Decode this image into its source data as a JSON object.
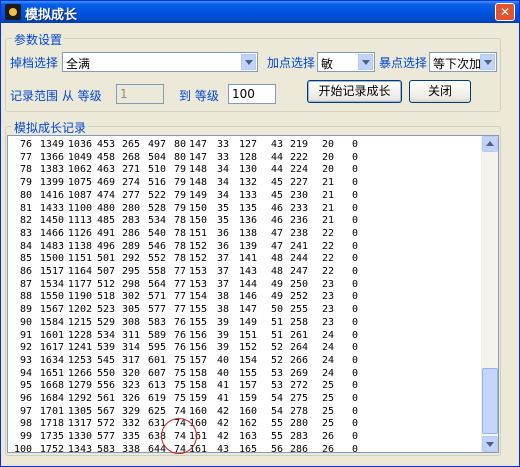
{
  "window": {
    "title": "模拟成长",
    "close_glyph": "✕"
  },
  "settings": {
    "legend": "参数设置",
    "grade_label": "掉档选择",
    "grade_value": "全满",
    "bonus_label": "加点选择",
    "bonus_value": "敏",
    "crit_label": "暴点选择",
    "crit_value": "等下次加",
    "range_label": "记录范围 从 等级",
    "range_from": "1",
    "range_to_label": "到 等级",
    "range_to": "100",
    "start_button": "开始记录成长",
    "close_button": "关闭"
  },
  "records": {
    "legend": "模拟成长记录",
    "rows": [
      [
        "76",
        "1349",
        "1036",
        "453",
        "265",
        "497",
        "80",
        "147",
        "33",
        "127",
        "43",
        "219",
        "20",
        "0"
      ],
      [
        "77",
        "1366",
        "1049",
        "458",
        "268",
        "504",
        "80",
        "147",
        "33",
        "128",
        "44",
        "222",
        "20",
        "0"
      ],
      [
        "78",
        "1383",
        "1062",
        "463",
        "271",
        "510",
        "79",
        "148",
        "34",
        "130",
        "44",
        "224",
        "20",
        "0"
      ],
      [
        "79",
        "1399",
        "1075",
        "469",
        "274",
        "516",
        "79",
        "148",
        "34",
        "132",
        "45",
        "227",
        "21",
        "0"
      ],
      [
        "80",
        "1416",
        "1087",
        "474",
        "277",
        "522",
        "79",
        "149",
        "34",
        "133",
        "45",
        "230",
        "21",
        "0"
      ],
      [
        "81",
        "1433",
        "1100",
        "480",
        "280",
        "528",
        "79",
        "150",
        "35",
        "135",
        "46",
        "233",
        "21",
        "0"
      ],
      [
        "82",
        "1450",
        "1113",
        "485",
        "283",
        "534",
        "78",
        "150",
        "35",
        "136",
        "46",
        "236",
        "21",
        "0"
      ],
      [
        "83",
        "1466",
        "1126",
        "491",
        "286",
        "540",
        "78",
        "151",
        "36",
        "138",
        "47",
        "238",
        "22",
        "0"
      ],
      [
        "84",
        "1483",
        "1138",
        "496",
        "289",
        "546",
        "78",
        "152",
        "36",
        "139",
        "47",
        "241",
        "22",
        "0"
      ],
      [
        "85",
        "1500",
        "1151",
        "501",
        "292",
        "552",
        "78",
        "152",
        "37",
        "141",
        "48",
        "244",
        "22",
        "0"
      ],
      [
        "86",
        "1517",
        "1164",
        "507",
        "295",
        "558",
        "77",
        "153",
        "37",
        "143",
        "48",
        "247",
        "22",
        "0"
      ],
      [
        "87",
        "1534",
        "1177",
        "512",
        "298",
        "564",
        "77",
        "153",
        "37",
        "144",
        "49",
        "250",
        "23",
        "0"
      ],
      [
        "88",
        "1550",
        "1190",
        "518",
        "302",
        "571",
        "77",
        "154",
        "38",
        "146",
        "49",
        "252",
        "23",
        "0"
      ],
      [
        "89",
        "1567",
        "1202",
        "523",
        "305",
        "577",
        "77",
        "155",
        "38",
        "147",
        "50",
        "255",
        "23",
        "0"
      ],
      [
        "90",
        "1584",
        "1215",
        "529",
        "308",
        "583",
        "76",
        "155",
        "39",
        "149",
        "51",
        "258",
        "23",
        "0"
      ],
      [
        "91",
        "1601",
        "1228",
        "534",
        "311",
        "589",
        "76",
        "156",
        "39",
        "151",
        "51",
        "261",
        "24",
        "0"
      ],
      [
        "92",
        "1617",
        "1241",
        "539",
        "314",
        "595",
        "76",
        "156",
        "39",
        "152",
        "52",
        "264",
        "24",
        "0"
      ],
      [
        "93",
        "1634",
        "1253",
        "545",
        "317",
        "601",
        "75",
        "157",
        "40",
        "154",
        "52",
        "266",
        "24",
        "0"
      ],
      [
        "94",
        "1651",
        "1266",
        "550",
        "320",
        "607",
        "75",
        "158",
        "40",
        "155",
        "53",
        "269",
        "24",
        "0"
      ],
      [
        "95",
        "1668",
        "1279",
        "556",
        "323",
        "613",
        "75",
        "158",
        "41",
        "157",
        "53",
        "272",
        "25",
        "0"
      ],
      [
        "96",
        "1684",
        "1292",
        "561",
        "326",
        "619",
        "75",
        "159",
        "41",
        "159",
        "54",
        "275",
        "25",
        "0"
      ],
      [
        "97",
        "1701",
        "1305",
        "567",
        "329",
        "625",
        "74",
        "160",
        "42",
        "160",
        "54",
        "278",
        "25",
        "0"
      ],
      [
        "98",
        "1718",
        "1317",
        "572",
        "332",
        "631",
        "74",
        "160",
        "42",
        "162",
        "55",
        "280",
        "25",
        "0"
      ],
      [
        "99",
        "1735",
        "1330",
        "577",
        "335",
        "638",
        "74",
        "161",
        "42",
        "163",
        "55",
        "283",
        "26",
        "0"
      ],
      [
        "100",
        "1752",
        "1343",
        "583",
        "338",
        "644",
        "74",
        "161",
        "43",
        "165",
        "56",
        "286",
        "26",
        "0"
      ]
    ]
  }
}
